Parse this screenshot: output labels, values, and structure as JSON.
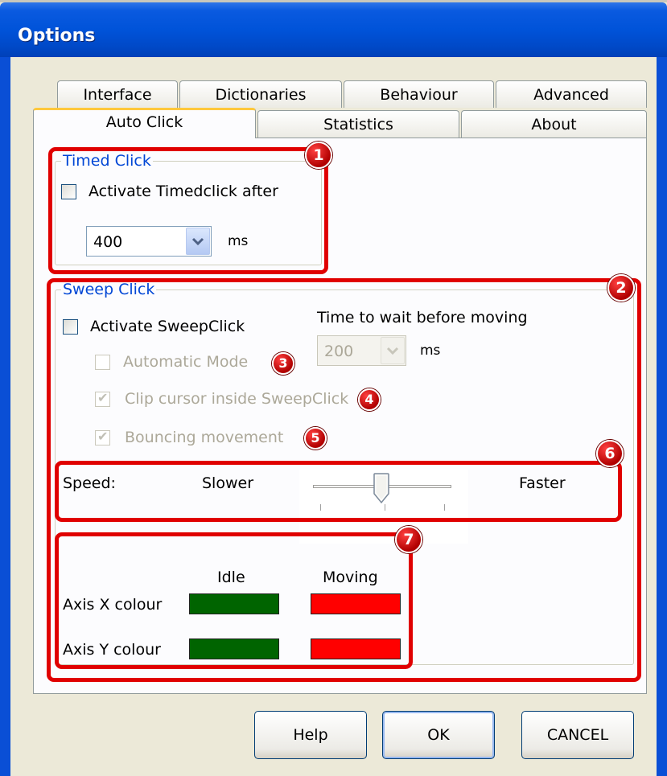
{
  "window": {
    "title": "Options"
  },
  "tabs": {
    "row1": [
      {
        "label": "Interface"
      },
      {
        "label": "Dictionaries"
      },
      {
        "label": "Behaviour"
      },
      {
        "label": "Advanced"
      }
    ],
    "row2": [
      {
        "label": "Auto Click",
        "active": true
      },
      {
        "label": "Statistics"
      },
      {
        "label": "About"
      }
    ]
  },
  "timed_click": {
    "title": "Timed Click",
    "activate_label": "Activate Timedclick after",
    "activate_checked": false,
    "delay_value": "400",
    "unit": "ms"
  },
  "sweep_click": {
    "title": "Sweep Click",
    "activate_label": "Activate SweepClick",
    "activate_checked": false,
    "wait_label": "Time to wait before moving",
    "wait_value": "200",
    "wait_unit": "ms",
    "automatic_mode_label": "Automatic Mode",
    "automatic_mode_checked": false,
    "clip_cursor_label": "Clip cursor inside SweepClick",
    "clip_cursor_checked": true,
    "bouncing_label": "Bouncing movement",
    "bouncing_checked": true
  },
  "speed": {
    "label": "Speed:",
    "slower_label": "Slower",
    "faster_label": "Faster",
    "level": 0.5
  },
  "colours": {
    "idle_header": "Idle",
    "moving_header": "Moving",
    "axis_x_label": "Axis X colour",
    "axis_y_label": "Axis Y colour",
    "idle_color": "#006400",
    "moving_color": "#ff0000"
  },
  "annotations": [
    "1",
    "2",
    "3",
    "4",
    "5",
    "6",
    "7"
  ],
  "buttons": {
    "help": "Help",
    "ok": "OK",
    "cancel": "CANCEL"
  }
}
